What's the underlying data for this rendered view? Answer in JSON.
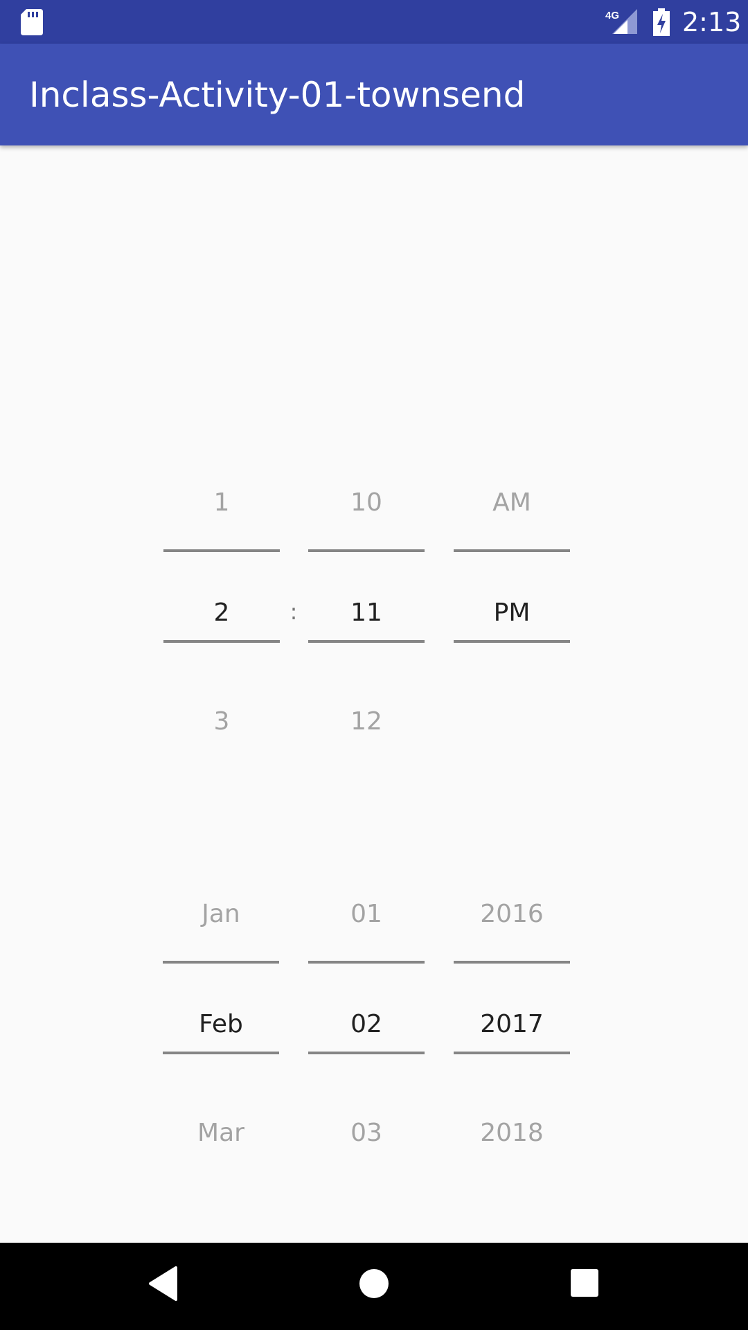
{
  "status_bar": {
    "network_label": "4G",
    "time": "2:13"
  },
  "app_bar": {
    "title": "Inclass-Activity-01-townsend"
  },
  "time_picker": {
    "hour": {
      "prev": "1",
      "current": "2",
      "next": "3"
    },
    "separator": ":",
    "minute": {
      "prev": "10",
      "current": "11",
      "next": "12"
    },
    "ampm": {
      "prev": "AM",
      "current": "PM",
      "next": ""
    }
  },
  "date_picker": {
    "month": {
      "prev": "Jan",
      "current": "Feb",
      "next": "Mar"
    },
    "day": {
      "prev": "01",
      "current": "02",
      "next": "03"
    },
    "year": {
      "prev": "2016",
      "current": "2017",
      "next": "2018"
    }
  },
  "nav_bar": {
    "icons": [
      "back-icon",
      "home-icon",
      "recents-icon"
    ]
  },
  "colors": {
    "status_bar": "#303f9f",
    "app_bar": "#3f51b5",
    "background": "#fafafa",
    "divider": "#858585",
    "selected_text": "#212121",
    "unselected_text": "#a3a3a3"
  }
}
